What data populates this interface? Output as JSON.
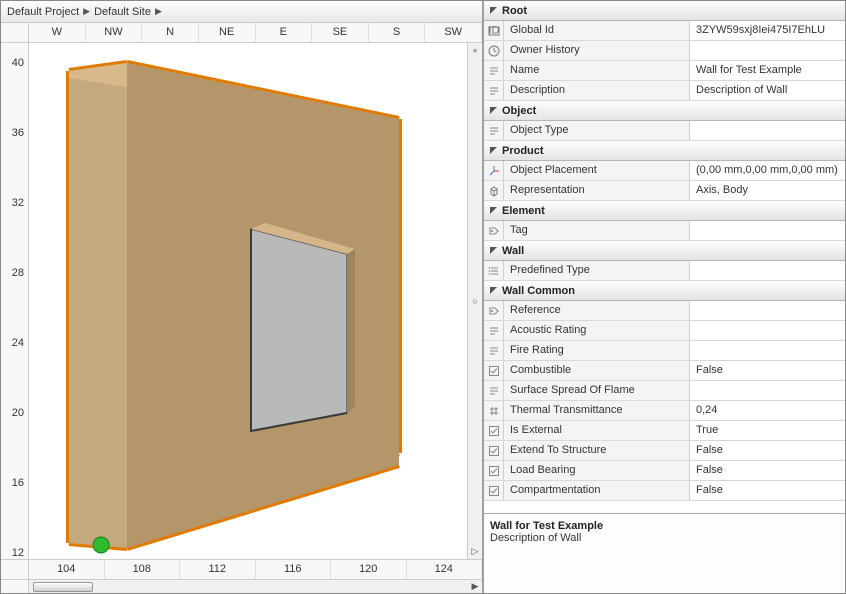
{
  "breadcrumb": {
    "item1": "Default Project",
    "item2": "Default Site"
  },
  "compass": {
    "items": [
      "W",
      "NW",
      "N",
      "NE",
      "E",
      "SE",
      "S",
      "SW"
    ]
  },
  "vruler": {
    "ticks": [
      "40",
      "36",
      "32",
      "28",
      "24",
      "20",
      "16",
      "12"
    ]
  },
  "hruler": {
    "ticks": [
      "104",
      "108",
      "112",
      "116",
      "120",
      "124"
    ]
  },
  "props": {
    "sections": [
      {
        "title": "Root",
        "rows": [
          {
            "icon": "id",
            "key": "Global Id",
            "val": "3ZYW59sxj8Iei475I7EhLU"
          },
          {
            "icon": "clock",
            "key": "Owner History",
            "val": ""
          },
          {
            "icon": "text",
            "key": "Name",
            "val": "Wall for Test Example"
          },
          {
            "icon": "text",
            "key": "Description",
            "val": "Description of Wall"
          }
        ]
      },
      {
        "title": "Object",
        "rows": [
          {
            "icon": "text",
            "key": "Object Type",
            "val": ""
          }
        ]
      },
      {
        "title": "Product",
        "rows": [
          {
            "icon": "axis",
            "key": "Object Placement",
            "val": "(0,00 mm,0,00 mm,0,00 mm)"
          },
          {
            "icon": "cube",
            "key": "Representation",
            "val": "Axis, Body"
          }
        ]
      },
      {
        "title": "Element",
        "rows": [
          {
            "icon": "tag",
            "key": "Tag",
            "val": ""
          }
        ]
      },
      {
        "title": "Wall",
        "rows": [
          {
            "icon": "list",
            "key": "Predefined Type",
            "val": ""
          }
        ]
      },
      {
        "title": "Wall Common",
        "rows": [
          {
            "icon": "tag",
            "key": "Reference",
            "val": ""
          },
          {
            "icon": "text",
            "key": "Acoustic Rating",
            "val": ""
          },
          {
            "icon": "text",
            "key": "Fire Rating",
            "val": ""
          },
          {
            "icon": "check",
            "key": "Combustible",
            "val": "False"
          },
          {
            "icon": "text",
            "key": "Surface Spread Of Flame",
            "val": ""
          },
          {
            "icon": "num",
            "key": "Thermal Transmittance",
            "val": "0,24"
          },
          {
            "icon": "check",
            "key": "Is External",
            "val": "True"
          },
          {
            "icon": "check",
            "key": "Extend To Structure",
            "val": "False"
          },
          {
            "icon": "check",
            "key": "Load Bearing",
            "val": "False"
          },
          {
            "icon": "check",
            "key": "Compartmentation",
            "val": "False"
          }
        ]
      }
    ]
  },
  "desc": {
    "title": "Wall for Test Example",
    "body": "Description of Wall"
  }
}
